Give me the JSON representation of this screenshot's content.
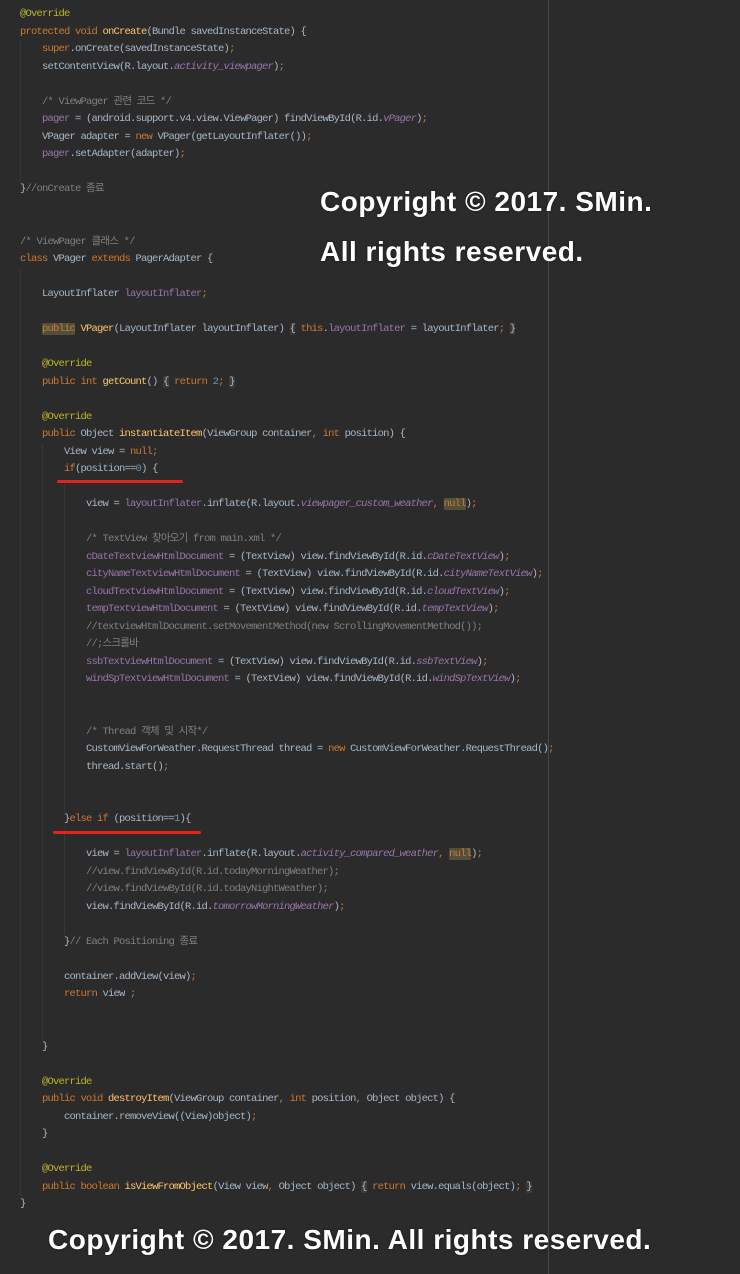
{
  "editor": {
    "background": "#2b2b2b",
    "lines": [
      [
        [
          "@Override",
          "#bbb529"
        ]
      ],
      [
        [
          "protected void ",
          "#cc7832"
        ],
        [
          "onCreate",
          "#ffc66d"
        ],
        [
          "(Bundle savedInstanceState) {",
          "#a9b7c6"
        ]
      ],
      [
        [
          "    ",
          "#a9b7c6"
        ],
        [
          "super",
          "#cc7832"
        ],
        [
          ".onCreate(savedInstanceState)",
          "#a9b7c6"
        ],
        [
          ";",
          "#cc7832"
        ]
      ],
      [
        [
          "    setContentView(R.layout.",
          "#a9b7c6"
        ],
        [
          "activity_viewpager",
          "#9876aa",
          null,
          true
        ],
        [
          ")",
          "#a9b7c6"
        ],
        [
          ";",
          "#cc7832"
        ]
      ],
      [],
      [
        [
          "    /* ViewPager 관련 코드 */",
          "#808080"
        ]
      ],
      [
        [
          "    ",
          "#a9b7c6"
        ],
        [
          "pager",
          "#9876aa"
        ],
        [
          " = (android.support.v4.view.ViewPager) findViewById(R.id.",
          "#a9b7c6"
        ],
        [
          "vPager",
          "#9876aa",
          null,
          true
        ],
        [
          ")",
          "#a9b7c6"
        ],
        [
          ";",
          "#cc7832"
        ]
      ],
      [
        [
          "    VPager adapter = ",
          "#a9b7c6"
        ],
        [
          "new",
          "#cc7832"
        ],
        [
          " VPager(getLayoutInflater())",
          "#a9b7c6"
        ],
        [
          ";",
          "#cc7832"
        ]
      ],
      [
        [
          "    ",
          "#a9b7c6"
        ],
        [
          "pager",
          "#9876aa"
        ],
        [
          ".setAdapter(adapter)",
          "#a9b7c6"
        ],
        [
          ";",
          "#cc7832"
        ]
      ],
      [],
      [
        [
          "}",
          "#a9b7c6"
        ],
        [
          "//onCreate 종료",
          "#808080"
        ]
      ],
      [],
      [],
      [
        [
          "/* ViewPager 클래스 */",
          "#808080"
        ]
      ],
      [
        [
          "class",
          "#cc7832"
        ],
        [
          " VPager ",
          "#a9b7c6"
        ],
        [
          "extends",
          "#cc7832"
        ],
        [
          " PagerAdapter {",
          "#a9b7c6"
        ]
      ],
      [],
      [
        [
          "    LayoutInflater ",
          "#a9b7c6"
        ],
        [
          "layoutInflater",
          "#9876aa"
        ],
        [
          ";",
          "#cc7832"
        ]
      ],
      [],
      [
        [
          "    ",
          "#a9b7c6"
        ],
        [
          "public",
          "#cc7832",
          "#52503a"
        ],
        [
          " ",
          "#a9b7c6"
        ],
        [
          "VPager",
          "#ffc66d"
        ],
        [
          "(LayoutInflater layoutInflater) ",
          "#a9b7c6"
        ],
        [
          "{",
          "#a9b7c6",
          "#3b3b3b"
        ],
        [
          " ",
          "#a9b7c6"
        ],
        [
          "this",
          "#cc7832"
        ],
        [
          ".",
          "#a9b7c6"
        ],
        [
          "layoutInflater",
          "#9876aa"
        ],
        [
          " = layoutInflater",
          "#a9b7c6"
        ],
        [
          ";",
          "#cc7832"
        ],
        [
          " ",
          "#a9b7c6"
        ],
        [
          "}",
          "#a9b7c6",
          "#3b3b3b"
        ]
      ],
      [],
      [
        [
          "    @Override",
          "#bbb529"
        ]
      ],
      [
        [
          "    ",
          "#a9b7c6"
        ],
        [
          "public int ",
          "#cc7832"
        ],
        [
          "getCount",
          "#ffc66d"
        ],
        [
          "() ",
          "#a9b7c6"
        ],
        [
          "{",
          "#a9b7c6",
          "#3b3b3b"
        ],
        [
          " ",
          "#a9b7c6"
        ],
        [
          "return ",
          "#cc7832"
        ],
        [
          "2",
          "#6897bb"
        ],
        [
          ";",
          "#cc7832"
        ],
        [
          " ",
          "#a9b7c6"
        ],
        [
          "}",
          "#a9b7c6",
          "#3b3b3b"
        ]
      ],
      [],
      [
        [
          "    @Override",
          "#bbb529"
        ]
      ],
      [
        [
          "    ",
          "#a9b7c6"
        ],
        [
          "public ",
          "#cc7832"
        ],
        [
          "Object ",
          "#a9b7c6"
        ],
        [
          "instantiateItem",
          "#ffc66d"
        ],
        [
          "(ViewGroup container",
          "#a9b7c6"
        ],
        [
          ", ",
          "#cc7832"
        ],
        [
          "int ",
          "#cc7832"
        ],
        [
          "position) {",
          "#a9b7c6"
        ]
      ],
      [
        [
          "        View view = ",
          "#a9b7c6"
        ],
        [
          "null;",
          "#cc7832"
        ]
      ],
      [
        [
          "        ",
          "#a9b7c6"
        ],
        [
          "if",
          "#cc7832"
        ],
        [
          "(position==",
          "#a9b7c6"
        ],
        [
          "0",
          "#6897bb"
        ],
        [
          ") {",
          "#a9b7c6"
        ]
      ],
      [],
      [
        [
          "            view = ",
          "#a9b7c6"
        ],
        [
          "layoutInflater",
          "#9876aa"
        ],
        [
          ".inflate(R.layout.",
          "#a9b7c6"
        ],
        [
          "viewpager_custom_weather",
          "#9876aa",
          null,
          true
        ],
        [
          ", ",
          "#cc7832"
        ],
        [
          "null",
          "#cc7832",
          "#52503a"
        ],
        [
          ")",
          "#a9b7c6"
        ],
        [
          ";",
          "#cc7832"
        ]
      ],
      [],
      [
        [
          "            /* TextView 찾아오기 from main.xml */",
          "#808080"
        ]
      ],
      [
        [
          "            ",
          "#a9b7c6"
        ],
        [
          "cDateTextviewHtmlDocument",
          "#9876aa"
        ],
        [
          " = (TextView) view.findViewById(R.id.",
          "#a9b7c6"
        ],
        [
          "cDateTextView",
          "#9876aa",
          null,
          true
        ],
        [
          ")",
          "#a9b7c6"
        ],
        [
          ";",
          "#cc7832"
        ]
      ],
      [
        [
          "            ",
          "#a9b7c6"
        ],
        [
          "cityNameTextviewHtmlDocument",
          "#9876aa"
        ],
        [
          " = (TextView) view.findViewById(R.id.",
          "#a9b7c6"
        ],
        [
          "cityNameTextView",
          "#9876aa",
          null,
          true
        ],
        [
          ")",
          "#a9b7c6"
        ],
        [
          ";",
          "#cc7832"
        ]
      ],
      [
        [
          "            ",
          "#a9b7c6"
        ],
        [
          "cloudTextviewHtmlDocument",
          "#9876aa"
        ],
        [
          " = (TextView) view.findViewById(R.id.",
          "#a9b7c6"
        ],
        [
          "cloudTextView",
          "#9876aa",
          null,
          true
        ],
        [
          ")",
          "#a9b7c6"
        ],
        [
          ";",
          "#cc7832"
        ]
      ],
      [
        [
          "            ",
          "#a9b7c6"
        ],
        [
          "tempTextviewHtmlDocument",
          "#9876aa"
        ],
        [
          " = (TextView) view.findViewById(R.id.",
          "#a9b7c6"
        ],
        [
          "tempTextView",
          "#9876aa",
          null,
          true
        ],
        [
          ")",
          "#a9b7c6"
        ],
        [
          ";",
          "#cc7832"
        ]
      ],
      [
        [
          "            //textviewHtmlDocument.setMovementMethod(new ScrollingMovementMethod());",
          "#808080"
        ]
      ],
      [
        [
          "            //;스크롤바",
          "#808080"
        ]
      ],
      [
        [
          "            ",
          "#a9b7c6"
        ],
        [
          "ssbTextviewHtmlDocument",
          "#9876aa"
        ],
        [
          " = (TextView) view.findViewById(R.id.",
          "#a9b7c6"
        ],
        [
          "ssbTextView",
          "#9876aa",
          null,
          true
        ],
        [
          ")",
          "#a9b7c6"
        ],
        [
          ";",
          "#cc7832"
        ]
      ],
      [
        [
          "            ",
          "#a9b7c6"
        ],
        [
          "windSpTextviewHtmlDocument",
          "#9876aa"
        ],
        [
          " = (TextView) view.findViewById(R.id.",
          "#a9b7c6"
        ],
        [
          "windSpTextView",
          "#9876aa",
          null,
          true
        ],
        [
          ")",
          "#a9b7c6"
        ],
        [
          ";",
          "#cc7832"
        ]
      ],
      [],
      [],
      [
        [
          "            /* Thread 객체 및 시작*/",
          "#808080"
        ]
      ],
      [
        [
          "            CustomViewForWeather.RequestThread thread = ",
          "#a9b7c6"
        ],
        [
          "new ",
          "#cc7832"
        ],
        [
          "CustomViewForWeather.RequestThread()",
          "#a9b7c6"
        ],
        [
          ";",
          "#cc7832"
        ]
      ],
      [
        [
          "            thread.start()",
          "#a9b7c6"
        ],
        [
          ";",
          "#cc7832"
        ]
      ],
      [],
      [],
      [
        [
          "        }",
          "#a9b7c6"
        ],
        [
          "else if ",
          "#cc7832"
        ],
        [
          "(position==",
          "#a9b7c6"
        ],
        [
          "1",
          "#6897bb"
        ],
        [
          "){",
          "#a9b7c6"
        ]
      ],
      [],
      [
        [
          "            view = ",
          "#a9b7c6"
        ],
        [
          "layoutInflater",
          "#9876aa"
        ],
        [
          ".inflate(R.layout.",
          "#a9b7c6"
        ],
        [
          "activity_compared_weather",
          "#9876aa",
          null,
          true
        ],
        [
          ", ",
          "#cc7832"
        ],
        [
          "null",
          "#cc7832",
          "#52503a"
        ],
        [
          ")",
          "#a9b7c6"
        ],
        [
          ";",
          "#cc7832"
        ]
      ],
      [
        [
          "            //view.findViewById(R.id.todayMorningWeather);",
          "#808080"
        ]
      ],
      [
        [
          "            //view.findViewById(R.id.todayNightWeather);",
          "#808080"
        ]
      ],
      [
        [
          "            view.findViewById(R.id.",
          "#a9b7c6"
        ],
        [
          "tomorrowMorningWeather",
          "#9876aa",
          null,
          true
        ],
        [
          ")",
          "#a9b7c6"
        ],
        [
          ";",
          "#cc7832"
        ]
      ],
      [],
      [
        [
          "        }",
          "#a9b7c6"
        ],
        [
          "// Each Positioning 종료",
          "#808080"
        ]
      ],
      [],
      [
        [
          "        container.addView(view)",
          "#a9b7c6"
        ],
        [
          ";",
          "#cc7832"
        ]
      ],
      [
        [
          "        ",
          "#a9b7c6"
        ],
        [
          "return ",
          "#cc7832"
        ],
        [
          "view ",
          "#a9b7c6"
        ],
        [
          ";",
          "#cc7832"
        ]
      ],
      [],
      [],
      [
        [
          "    }",
          "#a9b7c6"
        ]
      ],
      [],
      [
        [
          "    @Override",
          "#bbb529"
        ]
      ],
      [
        [
          "    ",
          "#a9b7c6"
        ],
        [
          "public void ",
          "#cc7832"
        ],
        [
          "destroyItem",
          "#ffc66d"
        ],
        [
          "(ViewGroup container",
          "#a9b7c6"
        ],
        [
          ", ",
          "#cc7832"
        ],
        [
          "int ",
          "#cc7832"
        ],
        [
          "position",
          "#a9b7c6"
        ],
        [
          ", ",
          "#cc7832"
        ],
        [
          "Object object) {",
          "#a9b7c6"
        ]
      ],
      [
        [
          "        container.removeView((View)object)",
          "#a9b7c6"
        ],
        [
          ";",
          "#cc7832"
        ]
      ],
      [
        [
          "    }",
          "#a9b7c6"
        ]
      ],
      [],
      [
        [
          "    @Override",
          "#bbb529"
        ]
      ],
      [
        [
          "    ",
          "#a9b7c6"
        ],
        [
          "public boolean ",
          "#cc7832"
        ],
        [
          "isViewFromObject",
          "#ffc66d"
        ],
        [
          "(View view",
          "#a9b7c6"
        ],
        [
          ", ",
          "#cc7832"
        ],
        [
          "Object object) ",
          "#a9b7c6"
        ],
        [
          "{",
          "#a9b7c6",
          "#3b3b3b"
        ],
        [
          " ",
          "#a9b7c6"
        ],
        [
          "return ",
          "#cc7832"
        ],
        [
          "view.equals(object)",
          "#a9b7c6"
        ],
        [
          ";",
          "#cc7832"
        ],
        [
          " ",
          "#a9b7c6"
        ],
        [
          "}",
          "#a9b7c6",
          "#3b3b3b"
        ]
      ],
      [
        [
          "}",
          "#a9b7c6"
        ]
      ]
    ]
  },
  "annotations": {
    "underline_color": "#e0241e"
  },
  "watermarks": {
    "color": "#ffffff",
    "top_line1": "Copyright © 2017. SMin.",
    "top_line2": "All rights reserved.",
    "bottom": "Copyright © 2017. SMin. All rights reserved."
  }
}
